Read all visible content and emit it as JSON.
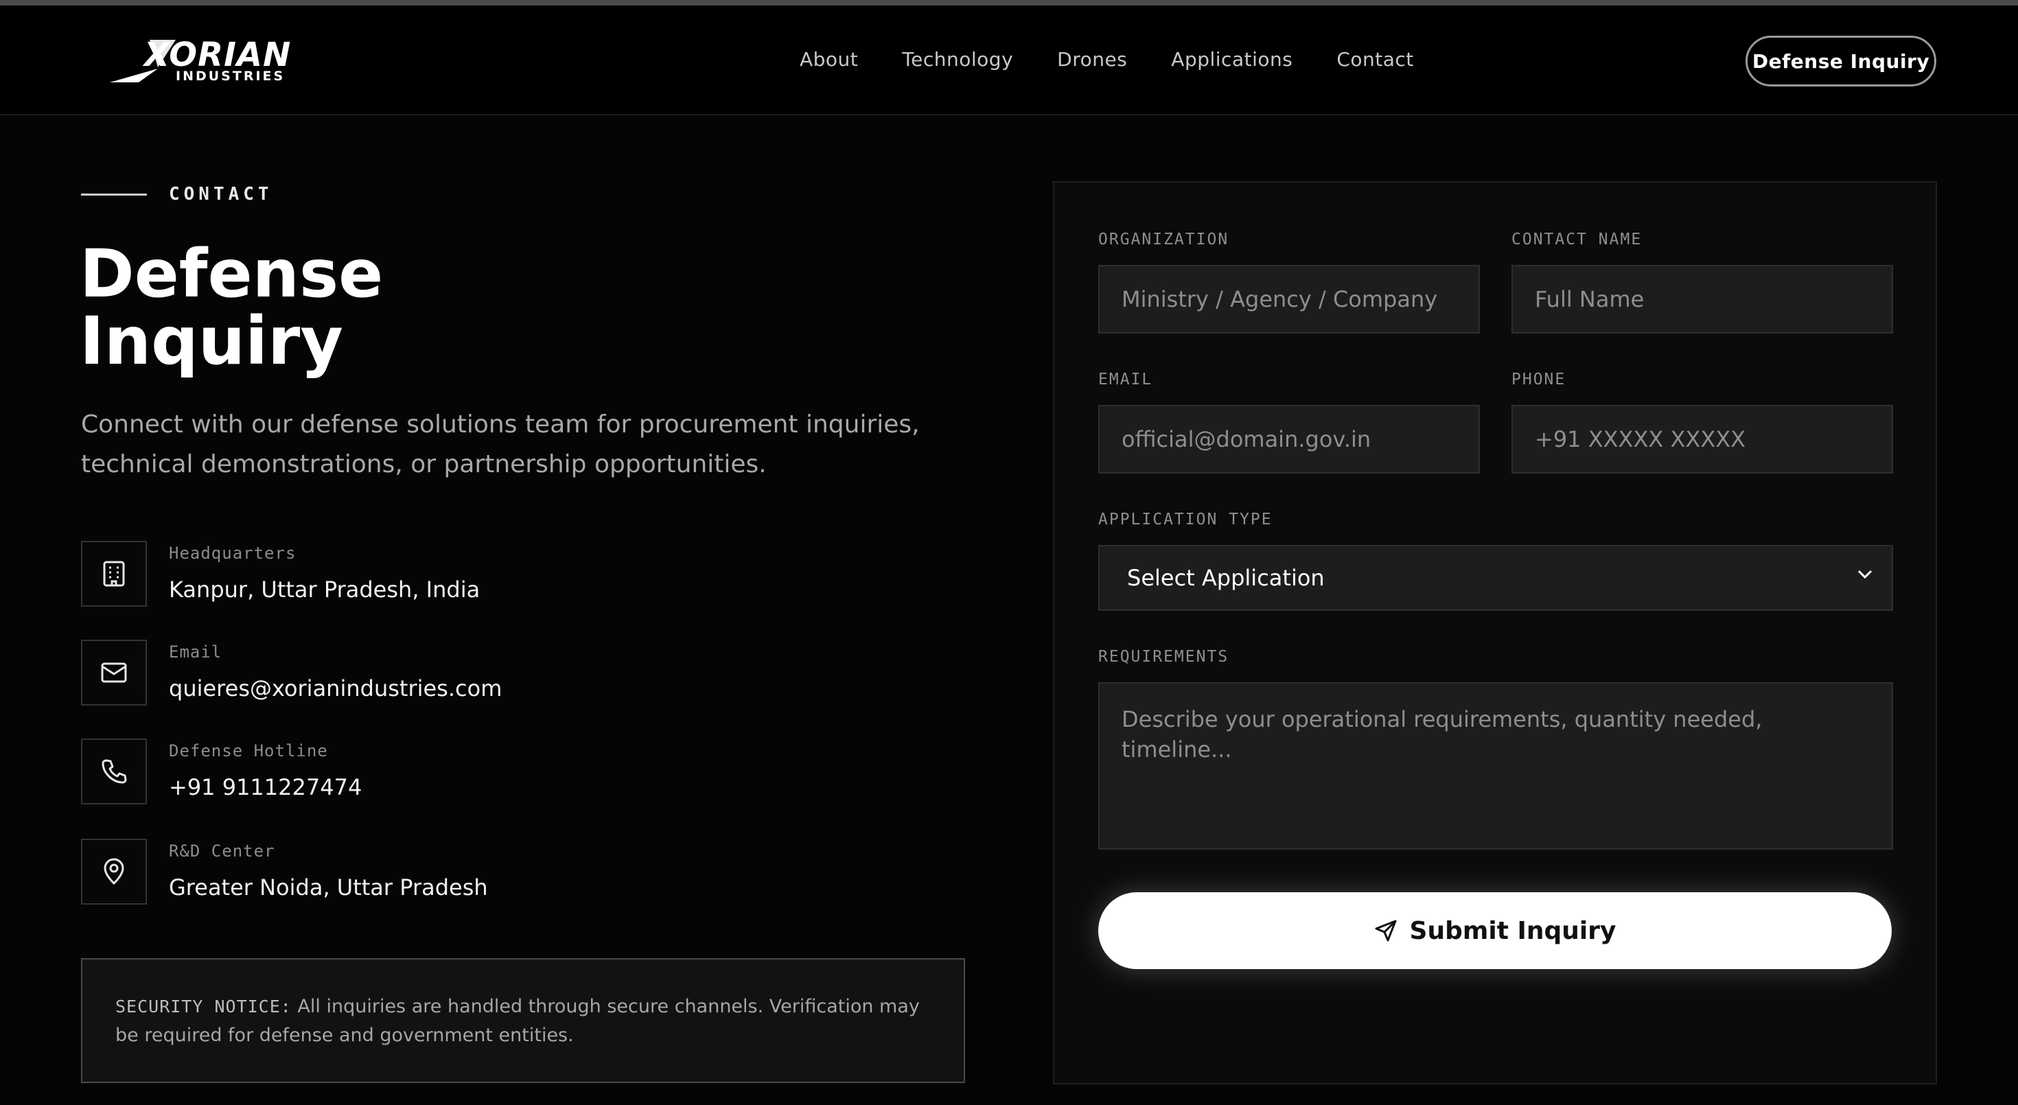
{
  "brand": {
    "name": "XORIAN",
    "sub": "INDUSTRIES"
  },
  "nav": {
    "links": [
      "About",
      "Technology",
      "Drones",
      "Applications",
      "Contact"
    ],
    "cta": "Defense Inquiry"
  },
  "hero": {
    "eyebrow": "CONTACT",
    "title_line1": "Defense",
    "title_line2": "Inquiry",
    "lead": "Connect with our defense solutions team for procurement inquiries, technical demonstrations, or partnership opportunities."
  },
  "info": [
    {
      "label": "Headquarters",
      "value": "Kanpur, Uttar Pradesh, India",
      "icon": "building-icon"
    },
    {
      "label": "Email",
      "value": "quieres@xorianindustries.com",
      "icon": "mail-icon"
    },
    {
      "label": "Defense Hotline",
      "value": "+91 9111227474",
      "icon": "phone-icon"
    },
    {
      "label": "R&D Center",
      "value": "Greater Noida, Uttar Pradesh",
      "icon": "map-pin-icon"
    }
  ],
  "notice": {
    "tag": "SECURITY NOTICE:",
    "text": "All inquiries are handled through secure channels. Verification may be required for defense and government entities."
  },
  "form": {
    "organization": {
      "label": "ORGANIZATION",
      "placeholder": "Ministry / Agency / Company"
    },
    "contact_name": {
      "label": "CONTACT NAME",
      "placeholder": "Full Name"
    },
    "email": {
      "label": "EMAIL",
      "placeholder": "official@domain.gov.in"
    },
    "phone": {
      "label": "PHONE",
      "placeholder": "+91 XXXXX XXXXX"
    },
    "application_type": {
      "label": "APPLICATION TYPE",
      "selected": "Select Application"
    },
    "requirements": {
      "label": "REQUIREMENTS",
      "placeholder": "Describe your operational requirements, quantity needed, timeline..."
    },
    "submit_label": "Submit Inquiry"
  },
  "colors": {
    "background": "#050505",
    "panel": "#0b0b0b",
    "field": "#1d1d1d",
    "accent": "#ffffff"
  }
}
